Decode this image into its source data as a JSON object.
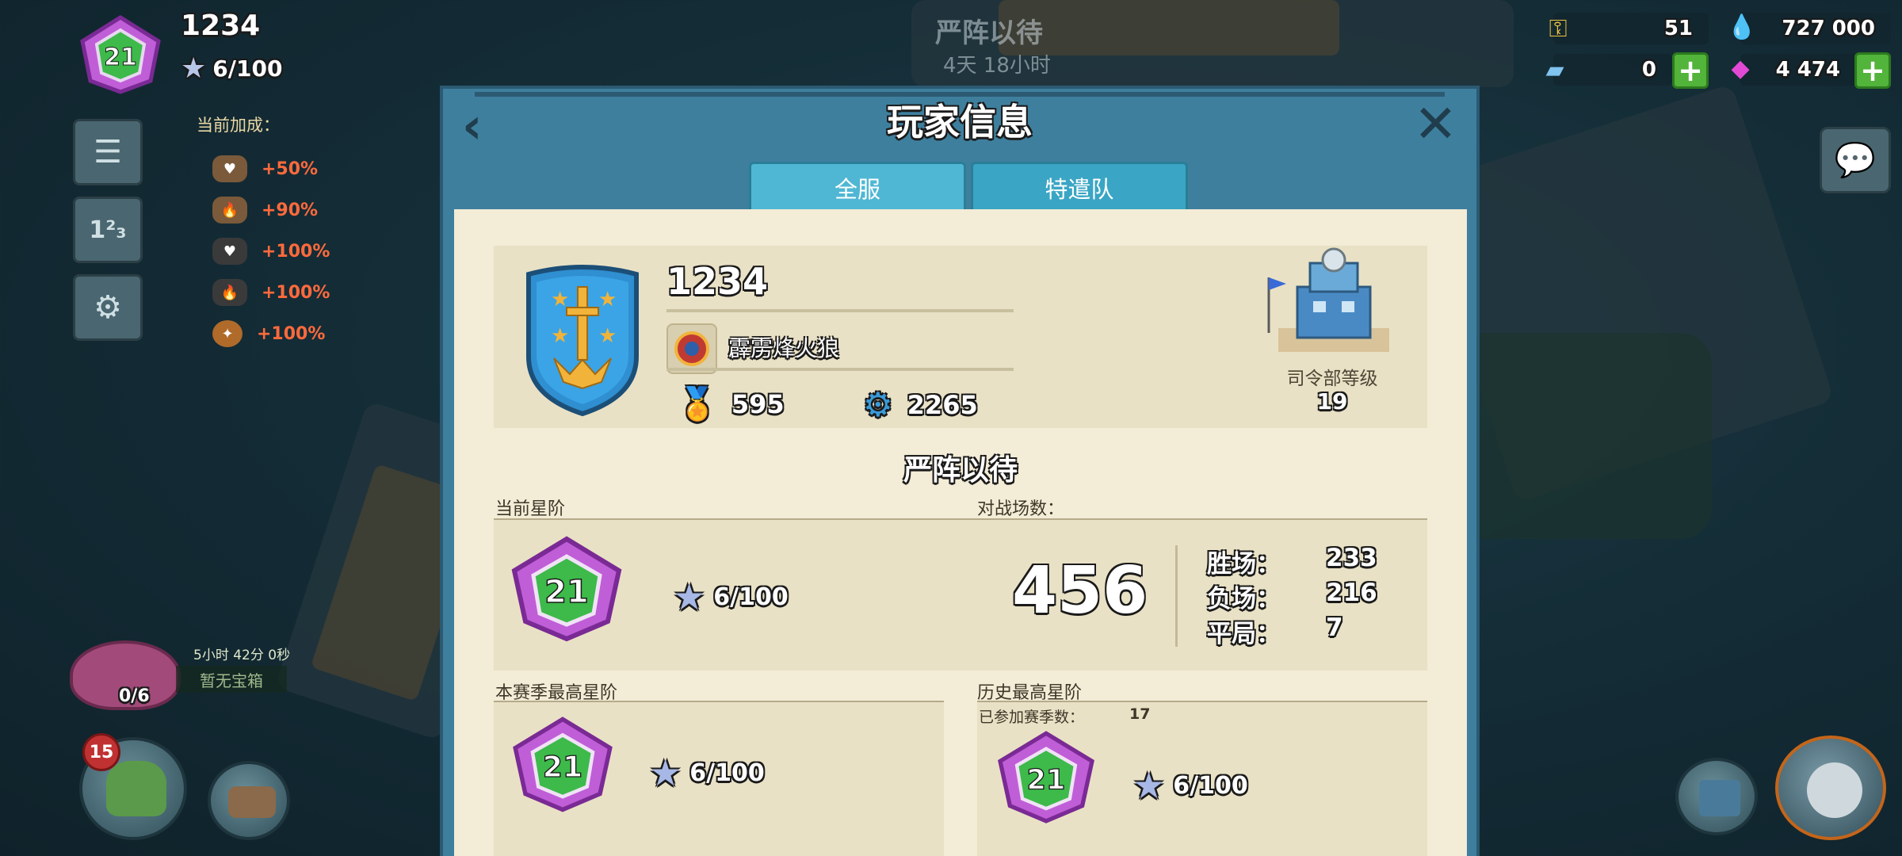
{
  "hud": {
    "player_name": "1234",
    "rank_level": "21",
    "stars": "6/100",
    "boost_title": "当前加成：",
    "boosts": [
      "+50%",
      "+90%",
      "+100%",
      "+100%",
      "+100%"
    ]
  },
  "event": {
    "title": "严阵以待",
    "time_left": "4天 18小时"
  },
  "chest": {
    "timer": "5小时 42分 0秒",
    "label": "暂无宝箱",
    "count": "0/6"
  },
  "bottom_left": {
    "troop_badge": "15"
  },
  "resources": {
    "keys": "51",
    "tickets": "0",
    "diamonds_blue": "727 000",
    "gems": "4 474"
  },
  "dialog": {
    "title": "玩家信息",
    "tabs": [
      "全服",
      "特遣队"
    ],
    "player": {
      "name": "1234",
      "clan": "霹雳烽火狼",
      "medals": "595",
      "power": "2265",
      "hq_label": "司令部等级",
      "hq_level": "19"
    },
    "season_title": "严阵以待",
    "current_rank_label": "当前星阶",
    "battles_label": "对战场数：",
    "current_rank": {
      "level": "21",
      "stars": "6/100"
    },
    "battles_total": "456",
    "results": [
      {
        "label": "胜场：",
        "value": "233"
      },
      {
        "label": "负场：",
        "value": "216"
      },
      {
        "label": "平局：",
        "value": "7"
      }
    ],
    "season_best_label": "本赛季最高星阶",
    "season_best": {
      "level": "21",
      "stars": "6/100"
    },
    "history_best_label": "历史最高星阶",
    "seasons_joined_label": "已参加赛季数：",
    "seasons_joined": "17",
    "history_best": {
      "level": "21",
      "stars": "6/100"
    }
  },
  "colors": {
    "dialog_frame": "#3f7f9e",
    "tab": "#3aa5c4",
    "paper": "#f3ecd6",
    "card": "#e9e1c5",
    "rank_purple": "#c05ed8",
    "rank_green": "#3dba4a",
    "plus_green": "#52b43a",
    "boost_orange": "#ff6a3c"
  },
  "icons": {
    "back": "chevron-left-icon",
    "close": "close-x-icon",
    "menu": "hamburger-menu-icon",
    "leaderboard": "podium-icon",
    "settings": "gear-icon",
    "chat": "chat-bubble-icon",
    "medal": "medal-icon",
    "power": "gear-power-icon",
    "star": "star-icon"
  }
}
